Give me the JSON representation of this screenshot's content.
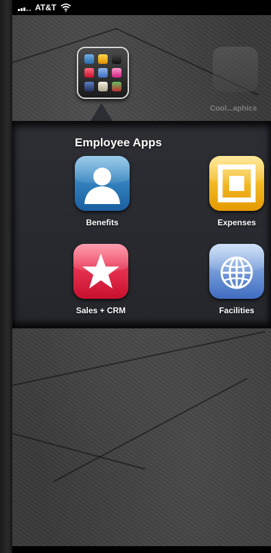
{
  "status_bar": {
    "carrier": "AT&T"
  },
  "folder": {
    "title": "Employee Apps",
    "apps": [
      {
        "label": "Benefits",
        "icon": "person-silhouette-icon"
      },
      {
        "label": "Expenses",
        "icon": "nested-square-icon"
      },
      {
        "label": "Sales + CRM",
        "icon": "star-icon"
      },
      {
        "label": "Facilities",
        "icon": "globe-icon"
      }
    ]
  },
  "background_app": {
    "label": "Cool...aphics"
  },
  "colors": {
    "benefits": "#1a5fa0",
    "expenses": "#f0b000",
    "sales": "#c8102e",
    "facilities": "#3f6cc0"
  }
}
